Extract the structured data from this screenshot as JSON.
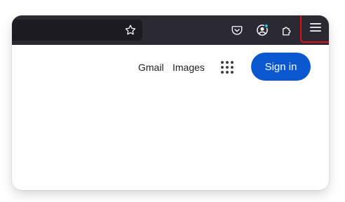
{
  "toolbar": {
    "bookmark_icon": "star-icon",
    "pocket_icon": "pocket-icon",
    "account_icon": "account-icon",
    "extensions_icon": "puzzle-icon",
    "menu_icon": "hamburger-menu-icon",
    "menu_highlight_color": "#e3101a",
    "notification_dot_color": "#2ac3f2"
  },
  "header": {
    "gmail_label": "Gmail",
    "images_label": "Images",
    "apps_icon": "apps-grid-icon",
    "signin_label": "Sign in",
    "signin_color": "#0b57d0"
  }
}
